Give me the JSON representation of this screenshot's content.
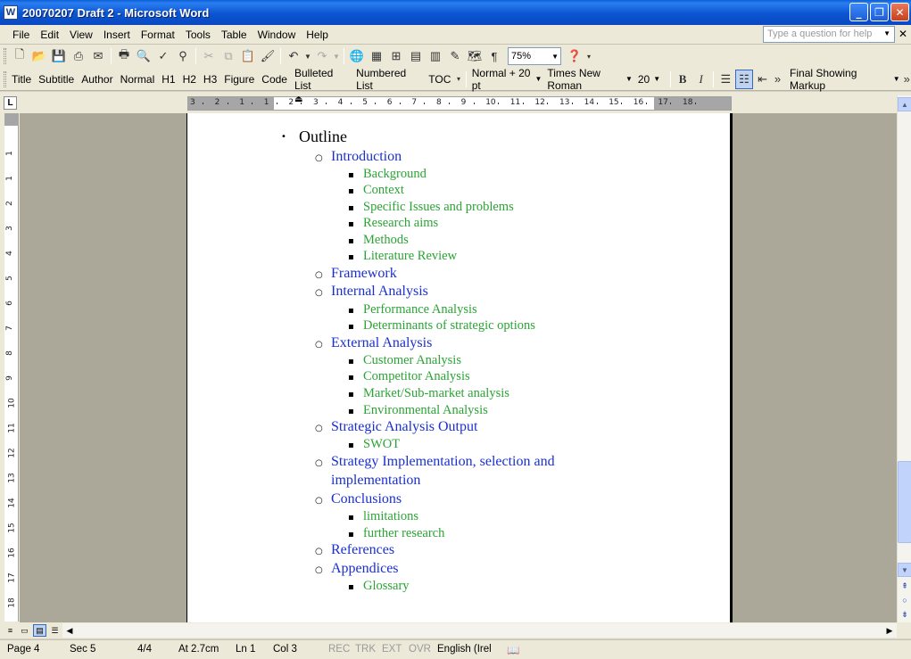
{
  "window": {
    "title": "20070207 Draft 2 - Microsoft Word",
    "app_icon": "W"
  },
  "menu": {
    "items": [
      "File",
      "Edit",
      "View",
      "Insert",
      "Format",
      "Tools",
      "Table",
      "Window",
      "Help"
    ],
    "help_placeholder": "Type a question for help"
  },
  "toolbar": {
    "zoom": "75%",
    "styles": [
      "Title",
      "Subtitle",
      "Author",
      "Normal",
      "H1",
      "H2",
      "H3",
      "Figure",
      "Code",
      "Bulleted List",
      "Numbered List",
      "TOC"
    ],
    "style_box": "Normal + 20 pt",
    "font_box": "Times New Roman",
    "size_box": "20",
    "bold": "B",
    "italic": "I",
    "markup_box": "Final Showing Markup"
  },
  "ruler": {
    "tab_selector": "L",
    "numbers": [
      "3",
      "2",
      "1",
      "1",
      "2",
      "3",
      "4",
      "5",
      "6",
      "7",
      "8",
      "9",
      "10",
      "11",
      "12",
      "13",
      "14",
      "15",
      "16",
      "17",
      "18"
    ],
    "vnumbers": [
      "1",
      "1",
      "2",
      "3",
      "4",
      "5",
      "6",
      "7",
      "8",
      "9",
      "10",
      "11",
      "12",
      "13",
      "14",
      "15",
      "16",
      "17",
      "18",
      "19"
    ]
  },
  "document": {
    "heading": "Outline",
    "sections": [
      {
        "label": "Introduction",
        "children": [
          "Background",
          "Context",
          "Specific Issues and problems",
          "Research aims",
          "Methods",
          "Literature Review"
        ]
      },
      {
        "label": "Framework",
        "children": []
      },
      {
        "label": "Internal Analysis",
        "children": [
          "Performance Analysis",
          "Determinants of strategic options"
        ]
      },
      {
        "label": "External Analysis",
        "children": [
          "Customer Analysis",
          "Competitor Analysis",
          "Market/Sub-market analysis",
          "Environmental Analysis"
        ]
      },
      {
        "label": "Strategic Analysis Output",
        "children": [
          "SWOT"
        ]
      },
      {
        "label": "Strategy Implementation, selection and",
        "label2": "implementation",
        "children": []
      },
      {
        "label": "Conclusions",
        "children": [
          "limitations",
          "further research"
        ]
      },
      {
        "label": "References",
        "children": []
      },
      {
        "label": "Appendices",
        "children": [
          "Glossary"
        ]
      }
    ]
  },
  "status": {
    "page": "Page 4",
    "sec": "Sec 5",
    "pages": "4/4",
    "at": "At 2.7cm",
    "ln": "Ln 1",
    "col": "Col 3",
    "rec": "REC",
    "trk": "TRK",
    "ext": "EXT",
    "ovr": "OVR",
    "language": "English (Irel"
  },
  "colors": {
    "level1": "#000000",
    "level2": "#1a2fd0",
    "level3": "#2aa434",
    "titlebar": "#0b55d2"
  }
}
